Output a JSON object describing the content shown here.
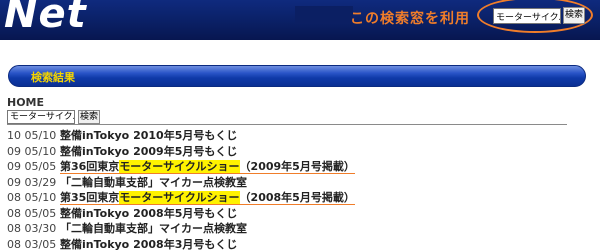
{
  "header": {
    "logo": "Net",
    "hint": "この検索窓を利用",
    "search_value": "モーターサイクル",
    "search_button": "検索"
  },
  "section": {
    "title": "検索結果"
  },
  "breadcrumb": {
    "home": "HOME"
  },
  "search": {
    "value": "モーターサイクル",
    "button": "検索"
  },
  "results": [
    {
      "date": "10 05/10",
      "pre": "整備inTokyo 2010年5月号もくじ",
      "hl": "",
      "post": "",
      "highlight": false
    },
    {
      "date": "09 05/10",
      "pre": "整備inTokyo 2009年5月号もくじ",
      "hl": "",
      "post": "",
      "highlight": false
    },
    {
      "date": "09 05/05",
      "pre": "第36回東京",
      "hl": "モーターサイクルショー",
      "post": "（2009年5月号掲載）",
      "highlight": true
    },
    {
      "date": "09 03/29",
      "pre": "「二輪自動車支部」マイカー点検教室",
      "hl": "",
      "post": "",
      "highlight": false
    },
    {
      "date": "08 05/10",
      "pre": "第35回東京",
      "hl": "モーターサイクルショー",
      "post": "（2008年5月号掲載）",
      "highlight": true
    },
    {
      "date": "08 05/05",
      "pre": "整備inTokyo 2008年5月号もくじ",
      "hl": "",
      "post": "",
      "highlight": false
    },
    {
      "date": "08 03/30",
      "pre": "「二輪自動車支部」マイカー点検教室",
      "hl": "",
      "post": "",
      "highlight": false
    },
    {
      "date": "08 03/05",
      "pre": "整備inTokyo 2008年3月号もくじ",
      "hl": "",
      "post": "",
      "highlight": false
    }
  ]
}
